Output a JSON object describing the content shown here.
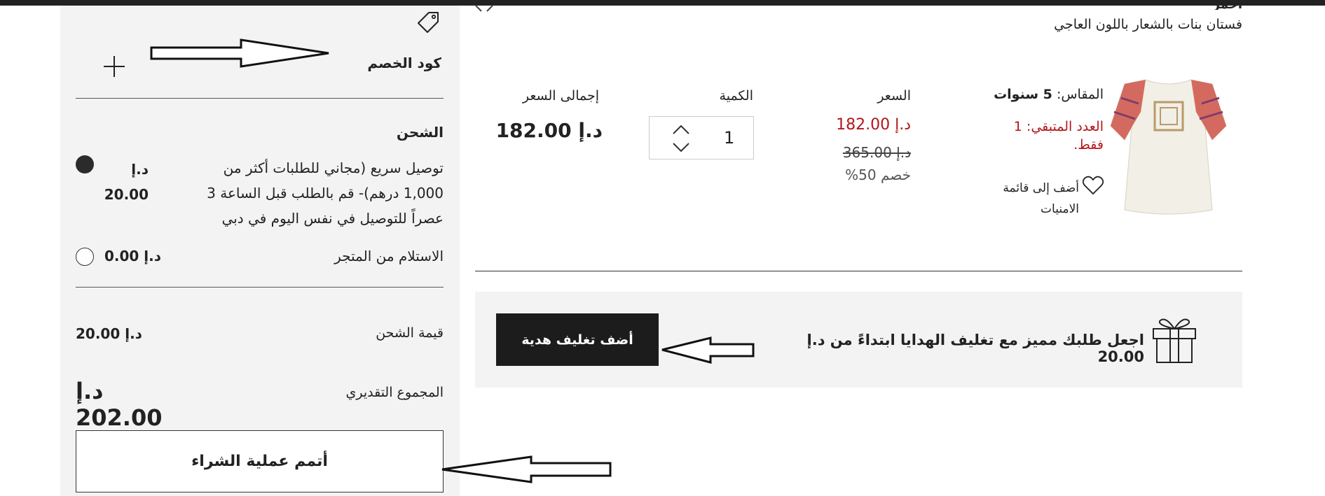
{
  "summary": {
    "promo_label": "كود الخصم",
    "shipping_heading": "الشحن",
    "shipping_options": [
      {
        "text": "توصيل سريع (مجاني للطلبات أكثر من 1,000 درهم)- قم بالطلب قبل الساعة 3 عصراً للتوصيل في نفس اليوم في دبي",
        "currency": "د.إ",
        "price": "20.00",
        "selected": true
      },
      {
        "text": "الاستلام من المتجر",
        "price": "د.إ 0.00",
        "selected": false
      }
    ],
    "shipping_cost_label": "قيمة الشحن",
    "shipping_cost_value": "د.إ 20.00",
    "estimated_total_label": "المجموع التقديري",
    "estimated_total_value": "د.إ 202.00",
    "checkout_label": "أتمم عملية الشراء"
  },
  "product": {
    "partial_label": "أحمر",
    "name": "فستان بنات بالشعار باللون العاجي",
    "size_label": "المقاس:",
    "size_value": "5 سنوات",
    "stock_line1": "العدد المتبقي: 1",
    "stock_line2": "فقط.",
    "wishlist_line1": "أضف إلى قائمة",
    "wishlist_line2": "الامنيات",
    "price_header": "السعر",
    "price_current": "د.إ 182.00",
    "price_original": "د.إ 365.00",
    "discount": "خصم 50%",
    "quantity_header": "الكمية",
    "quantity_value": "1",
    "total_header": "إجمالى السعر",
    "total_value": "د.إ 182.00"
  },
  "gift": {
    "message": "اجعل طلبك مميز مع تغليف الهدايا ابتداءً من د.إ 20.00",
    "button_label": "أضف تغليف هدية"
  },
  "colors": {
    "accent_red": "#b3161b",
    "dark": "#1c1c1c",
    "panel_bg": "#f3f3f3"
  }
}
